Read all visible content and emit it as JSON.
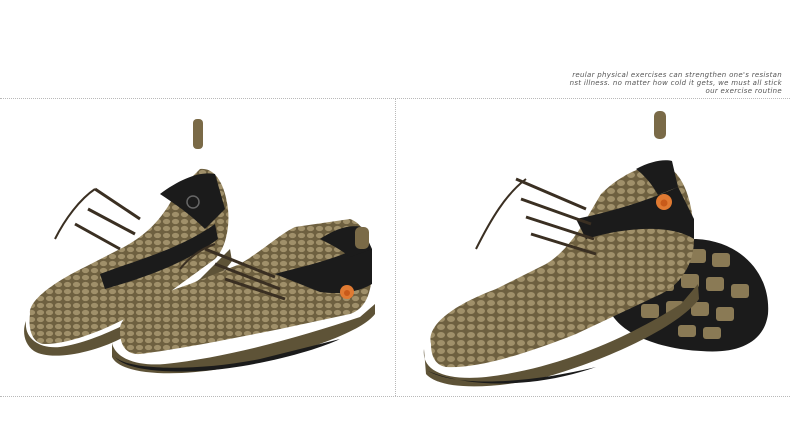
{
  "caption": {
    "line1": "reular physical exercises can strengthen one's resistan",
    "line2": "nst illness. no matter how cold it gets, we must all stick",
    "line3": "our exercise routine"
  },
  "photos": [
    {
      "alt": "Pair of brown mesh slip-on water shoes with elastic bungee laces"
    },
    {
      "alt": "Brown mesh water shoe side view with black rubber sole showing tread"
    }
  ],
  "colors": {
    "mesh": "#7a6a47",
    "mesh_light": "#9a8a62",
    "sole": "#5e5337",
    "trim": "#1b1b1b",
    "logo": "#e07a32"
  }
}
